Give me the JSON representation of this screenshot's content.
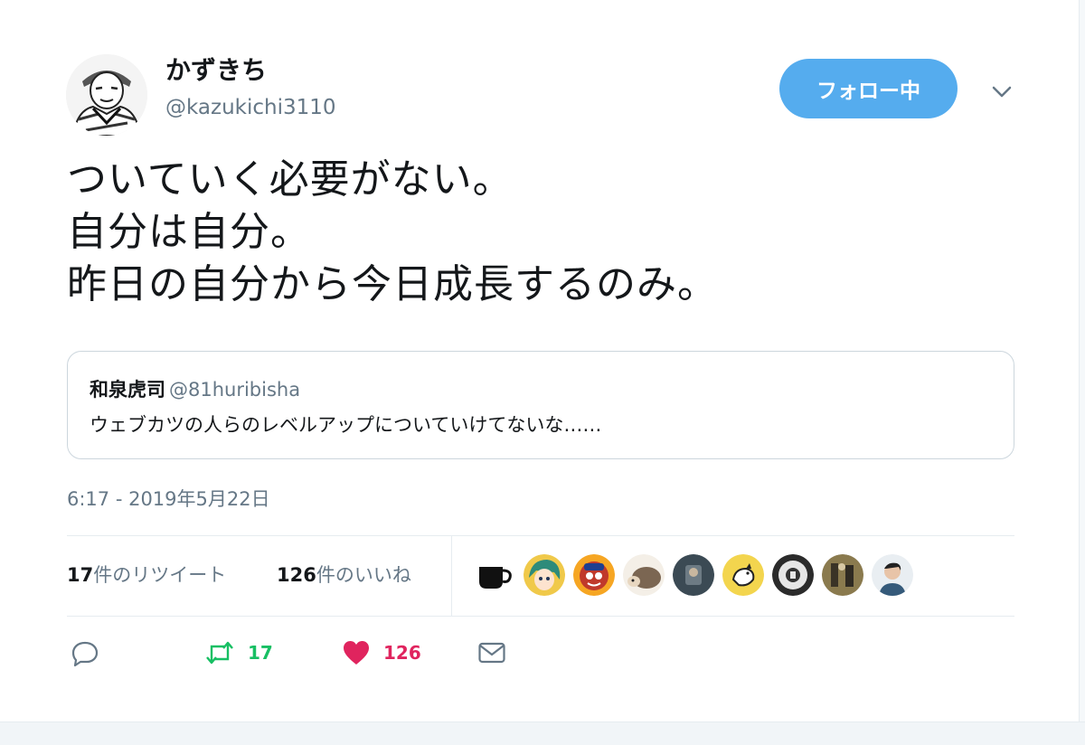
{
  "author": {
    "name": "かずきち",
    "handle": "@kazukichi3110",
    "avatar_icon": "manga-avatar-icon"
  },
  "header": {
    "follow_label": "フォロー中",
    "caret_icon": "chevron-down-icon"
  },
  "tweet": {
    "lines": [
      "ついていく必要がない。",
      "自分は自分。",
      "昨日の自分から今日成長するのみ。"
    ],
    "timestamp": "6:17 - 2019年5月22日"
  },
  "quoted": {
    "name": "和泉虎司",
    "handle": "@81huribisha",
    "text": "ウェブカツの人らのレベルアップについていけてないな……"
  },
  "stats": {
    "retweets_count": "17",
    "retweets_label": "件のリツイート",
    "likes_count": "126",
    "likes_label": "件のいいね"
  },
  "likers": [
    "coffee-cup-avatar",
    "anime-girl-avatar",
    "mascot-avatar",
    "hedgehog-avatar",
    "photo-avatar",
    "chicken-avatar",
    "drum-avatar",
    "sports-avatar",
    "person-avatar"
  ],
  "actions": {
    "reply_icon": "reply-icon",
    "retweet_icon": "retweet-icon",
    "retweet_count": "17",
    "like_icon": "heart-icon",
    "like_count": "126",
    "dm_icon": "envelope-icon"
  },
  "colors": {
    "accent": "#55acee",
    "retweet": "#17bf63",
    "like": "#e0245e",
    "muted": "#657786",
    "border": "#e6ecf0"
  }
}
